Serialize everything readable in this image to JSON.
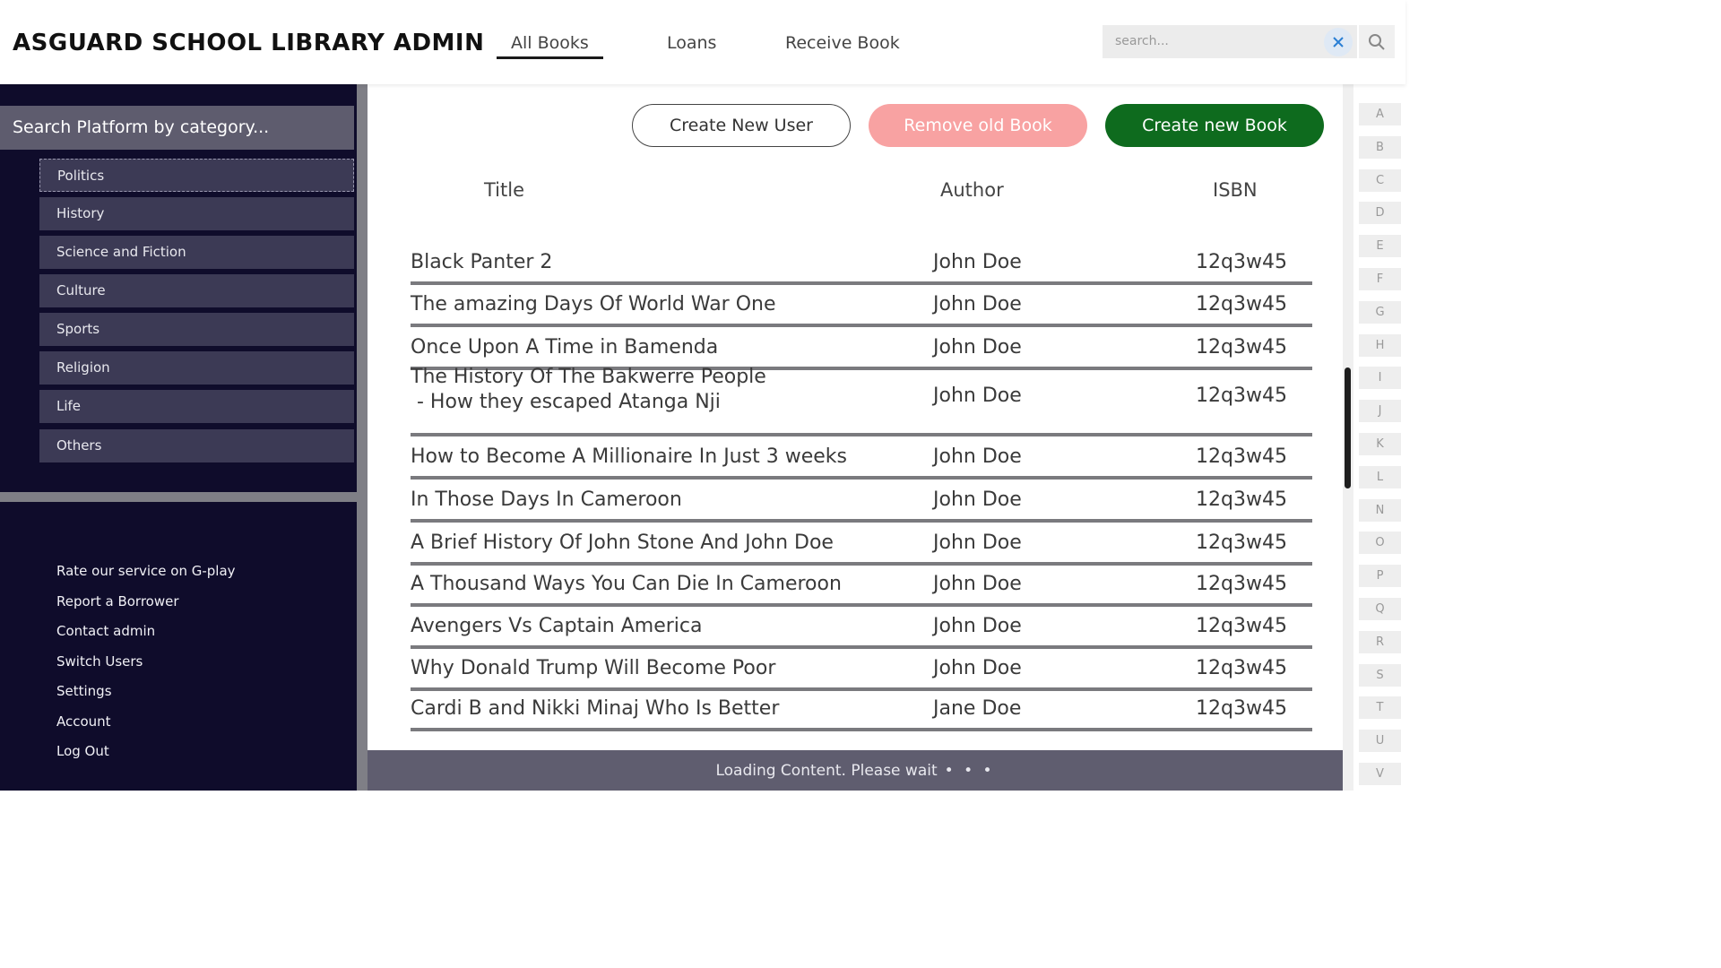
{
  "header": {
    "title": "ASGUARD SCHOOL LIBRARY ADMIN",
    "tabs": [
      {
        "label": "All Books",
        "active": true
      },
      {
        "label": "Loans",
        "active": false
      },
      {
        "label": "Receive Book",
        "active": false
      }
    ],
    "search": {
      "placeholder": "search...",
      "value": ""
    }
  },
  "sidebar": {
    "heading": "Search Platform by category...",
    "categories": [
      "Politics",
      "History",
      "Science and Fiction",
      "Culture",
      "Sports",
      "Religion",
      "Life",
      "Others"
    ],
    "selected_category": "Politics",
    "links": [
      "Rate our service on G-play",
      "Report a Borrower",
      "Contact admin",
      "Switch Users",
      "Settings",
      "Account",
      "Log Out"
    ]
  },
  "main": {
    "buttons": {
      "create_user": "Create New User",
      "remove_book": "Remove old Book",
      "create_book": "Create new Book"
    },
    "columns": {
      "title": "Title",
      "author": "Author",
      "isbn": "ISBN"
    },
    "books": [
      {
        "title": "Black Panter 2",
        "author": "John Doe",
        "isbn": "12q3w45"
      },
      {
        "title": "The amazing Days Of World War One",
        "author": "John Doe",
        "isbn": "12q3w45"
      },
      {
        "title": "Once Upon A Time in Bamenda",
        "author": "John Doe",
        "isbn": "12q3w45"
      },
      {
        "title": "The History Of The Bakwerre People",
        "subtitle": " - How they escaped Atanga Nji",
        "author": "John Doe",
        "isbn": "12q3w45"
      },
      {
        "title": "How to Become A Millionaire In Just 3 weeks",
        "author": "John Doe",
        "isbn": "12q3w45"
      },
      {
        "title": "In Those Days In Cameroon",
        "author": "John Doe",
        "isbn": "12q3w45"
      },
      {
        "title": "A Brief History Of John Stone And John Doe",
        "author": "John Doe",
        "isbn": "12q3w45"
      },
      {
        "title": "A Thousand Ways You Can Die In Cameroon",
        "author": "John Doe",
        "isbn": "12q3w45"
      },
      {
        "title": "Avengers Vs Captain America",
        "author": "John Doe",
        "isbn": "12q3w45"
      },
      {
        "title": "Why Donald Trump Will Become Poor",
        "author": "John Doe",
        "isbn": "12q3w45"
      },
      {
        "title": "Cardi B and Nikki Minaj Who Is Better",
        "author": "Jane Doe",
        "isbn": "12q3w45"
      }
    ],
    "loading": {
      "text": "Loading Content. Please wait",
      "dots": "• • •"
    }
  },
  "alphabet": [
    "A",
    "B",
    "C",
    "D",
    "E",
    "F",
    "G",
    "H",
    "I",
    "J",
    "K",
    "L",
    "N",
    "O",
    "P",
    "Q",
    "R",
    "S",
    "T",
    "U",
    "V"
  ],
  "colors": {
    "sidebar_bg": "#0f0c2b",
    "category_bg": "#3c3a55",
    "remove_button": "#f8a2a2",
    "create_button": "#0e6b1e",
    "loading_bar": "#5f5d6f"
  },
  "icons": {
    "clear": "close-icon",
    "search": "search-icon"
  }
}
